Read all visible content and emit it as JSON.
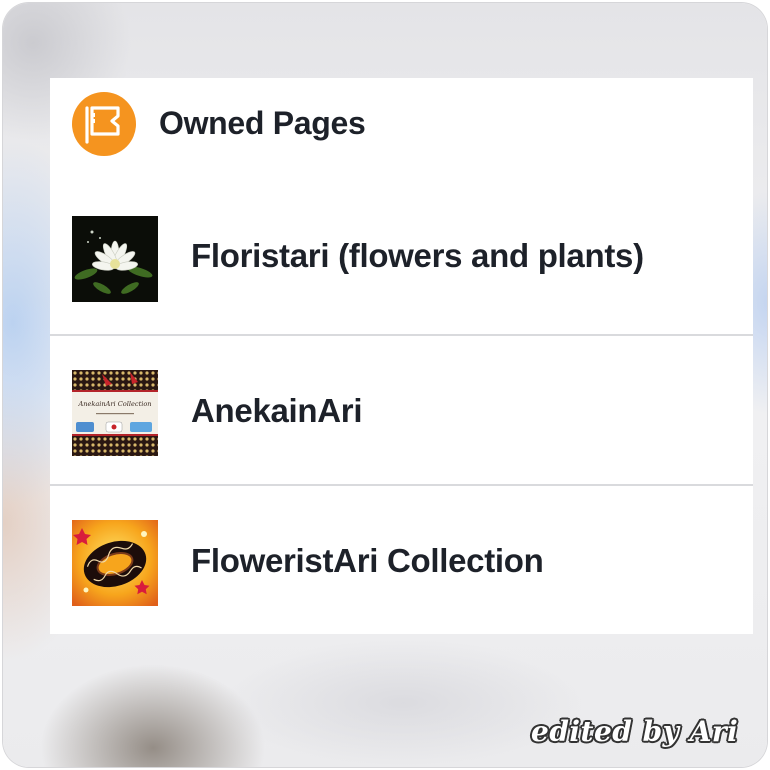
{
  "section": {
    "title": "Owned Pages",
    "icon": "flag-icon",
    "icon_color": "#f5941f"
  },
  "pages": [
    {
      "name": "Floristari (flowers and plants)",
      "thumbnail": "white-flower-thumbnail"
    },
    {
      "name": "AnekainAri",
      "thumbnail": "anekainari-collection-thumbnail",
      "thumbnail_text": "AnekainAri Collection"
    },
    {
      "name": "FloweristAri Collection",
      "thumbnail": "bracelet-thumbnail"
    }
  ],
  "watermark": "edited by Ari"
}
